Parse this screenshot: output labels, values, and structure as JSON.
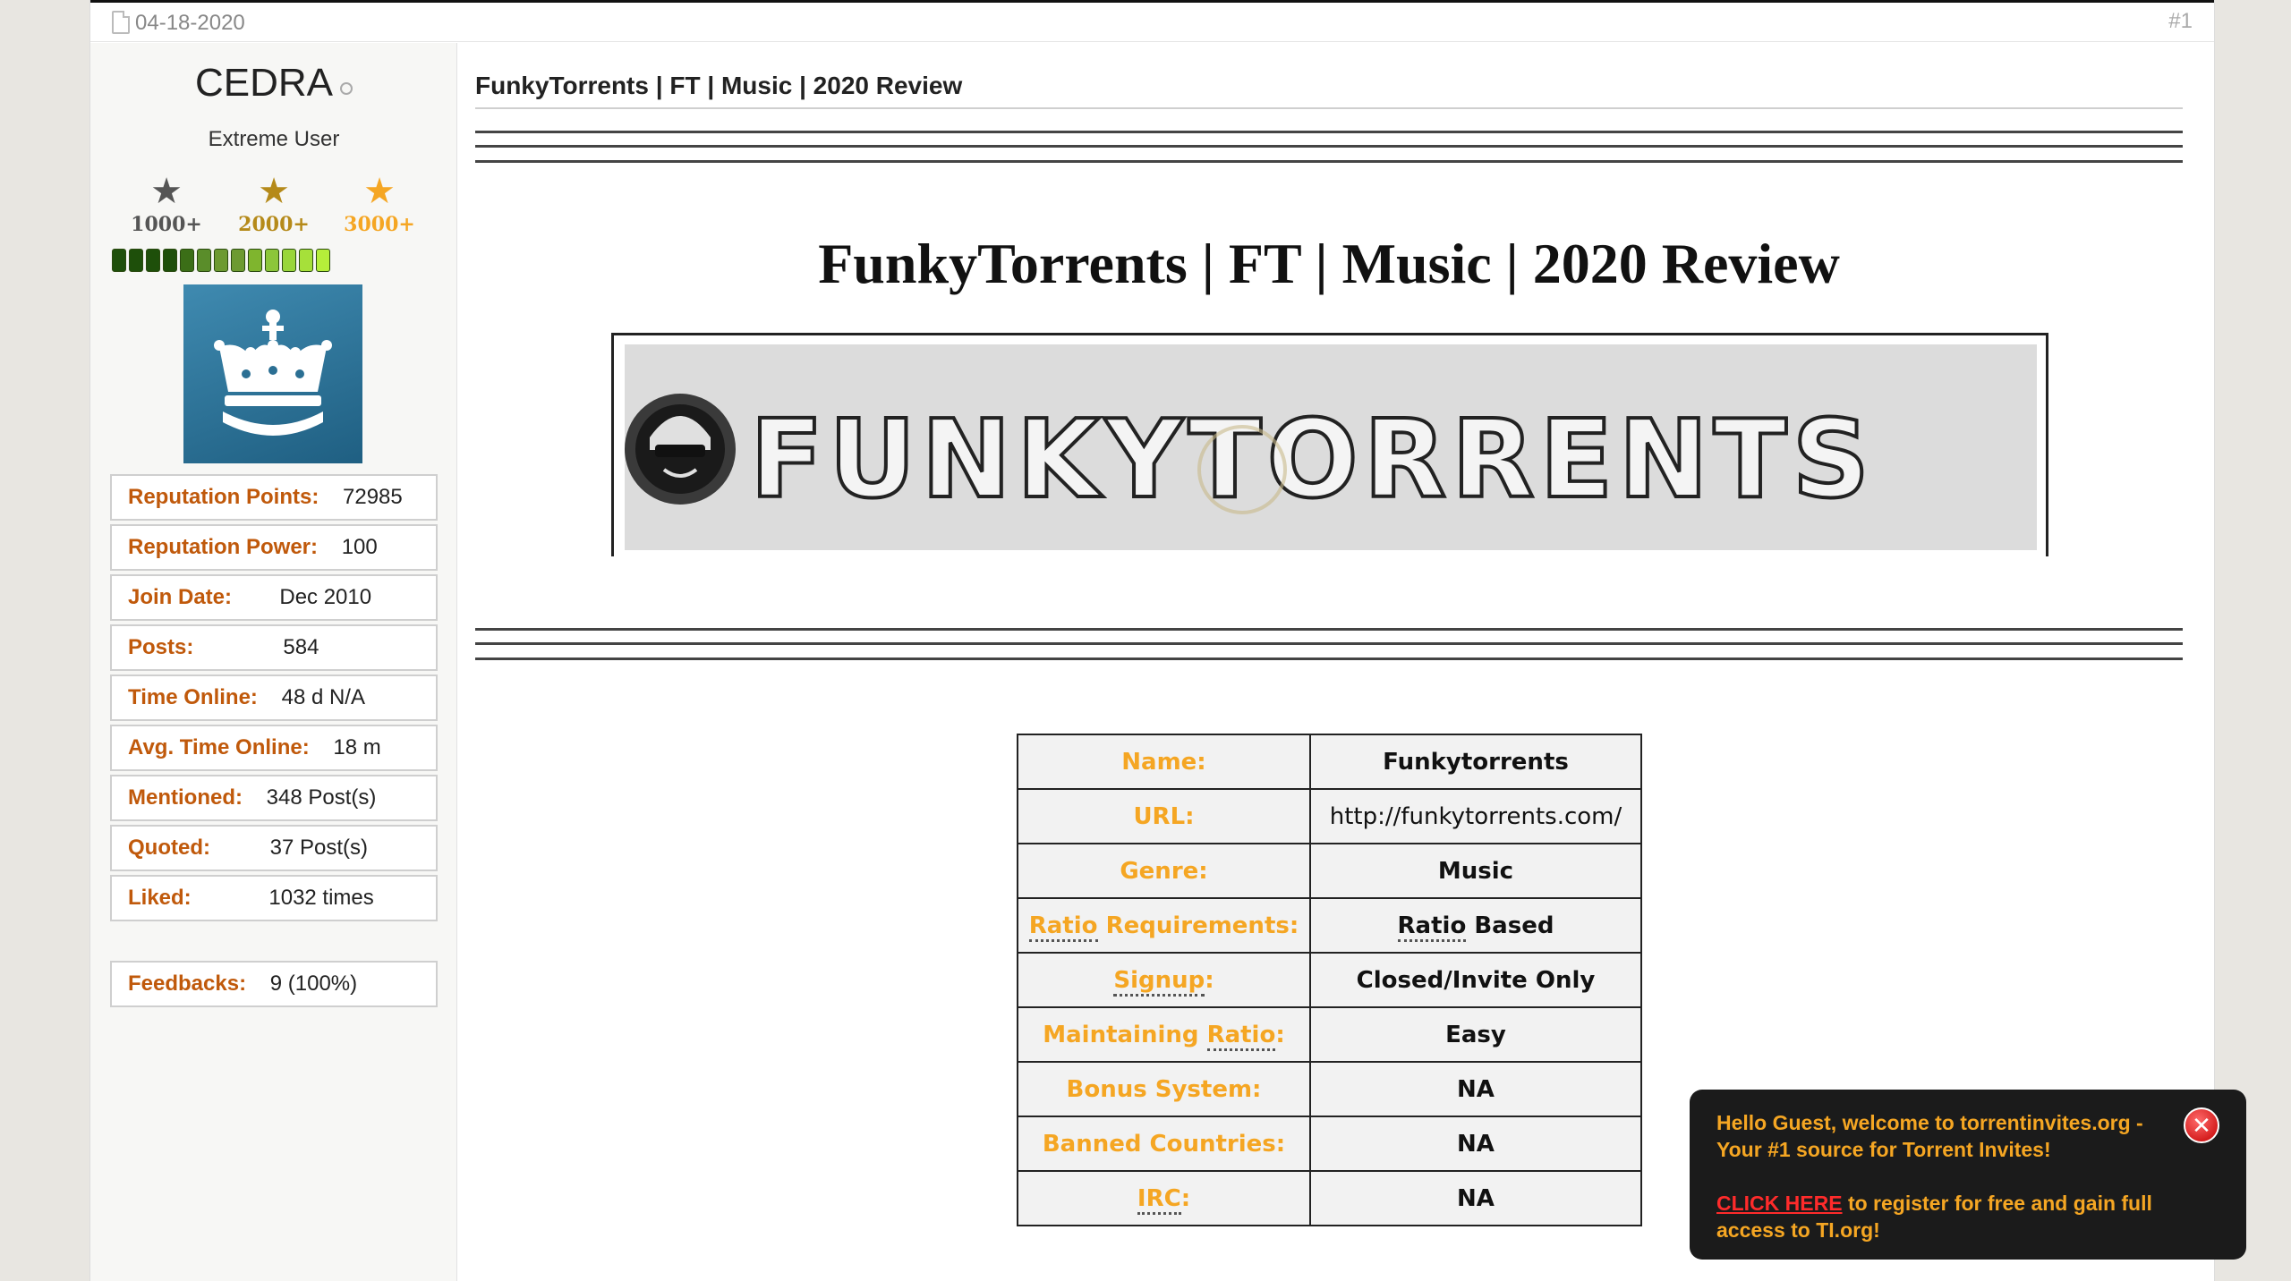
{
  "post": {
    "date": "04-18-2020",
    "number": "#1"
  },
  "user": {
    "name": "CEDRA",
    "title": "Extreme User",
    "ranks": [
      {
        "label": "1000+",
        "color": "#555555"
      },
      {
        "label": "2000+",
        "color": "#b58a1a"
      },
      {
        "label": "3000+",
        "color": "#f5a623"
      }
    ],
    "reputation_segments": 13,
    "info": [
      {
        "label": "Reputation Points:",
        "value": "72985"
      },
      {
        "label": "Reputation Power:",
        "value": "100"
      },
      {
        "label": "Join Date:",
        "value": "Dec 2010"
      },
      {
        "label": "Posts:",
        "value": "584"
      },
      {
        "label": "Time Online:",
        "value": "48 d N/A"
      },
      {
        "label": "Avg. Time Online:",
        "value": "18 m"
      },
      {
        "label": "Mentioned:",
        "value": "348 Post(s)"
      },
      {
        "label": "Quoted:",
        "value": "37 Post(s)"
      },
      {
        "label": "Liked:",
        "value": "1032 times"
      }
    ],
    "feedbacks": {
      "label": "Feedbacks:",
      "value": "9 (100%)"
    }
  },
  "thread": {
    "title": "FunkyTorrents | FT | Music | 2020 Review",
    "heading": "FunkyTorrents | FT | Music | 2020 Review",
    "banner_text": "FUNKYTORRENTS"
  },
  "details": [
    {
      "label": "Name:",
      "value": "Funkytorrents"
    },
    {
      "label": "URL:",
      "value": "http://funkytorrents.com/"
    },
    {
      "label": "Genre:",
      "value": "Music"
    },
    {
      "label_ul": "Ratio",
      "label_rest": " Requirements:",
      "value_ul": "Ratio",
      "value_rest": " Based"
    },
    {
      "label_ul": "Signup",
      "label_rest": ":",
      "value": "Closed/Invite Only"
    },
    {
      "label_pre": "Maintaining ",
      "label_ul": "Ratio",
      "label_rest": ":",
      "value": "Easy"
    },
    {
      "label": "Bonus System:",
      "value": "NA"
    },
    {
      "label": "Banned Countries:",
      "value": "NA"
    },
    {
      "label_ul": "IRC",
      "label_rest": ":",
      "value": "NA"
    }
  ],
  "popup": {
    "line1": "Hello Guest, welcome to torrentinvites.org - Your #1 source for Torrent Invites!",
    "click": "CLICK HERE",
    "line2_rest": " to register for free and gain full access to TI.org!"
  },
  "colors": {
    "label_orange": "#c0590b",
    "table_label": "#f5a623",
    "link_red": "#ff2b2b"
  }
}
